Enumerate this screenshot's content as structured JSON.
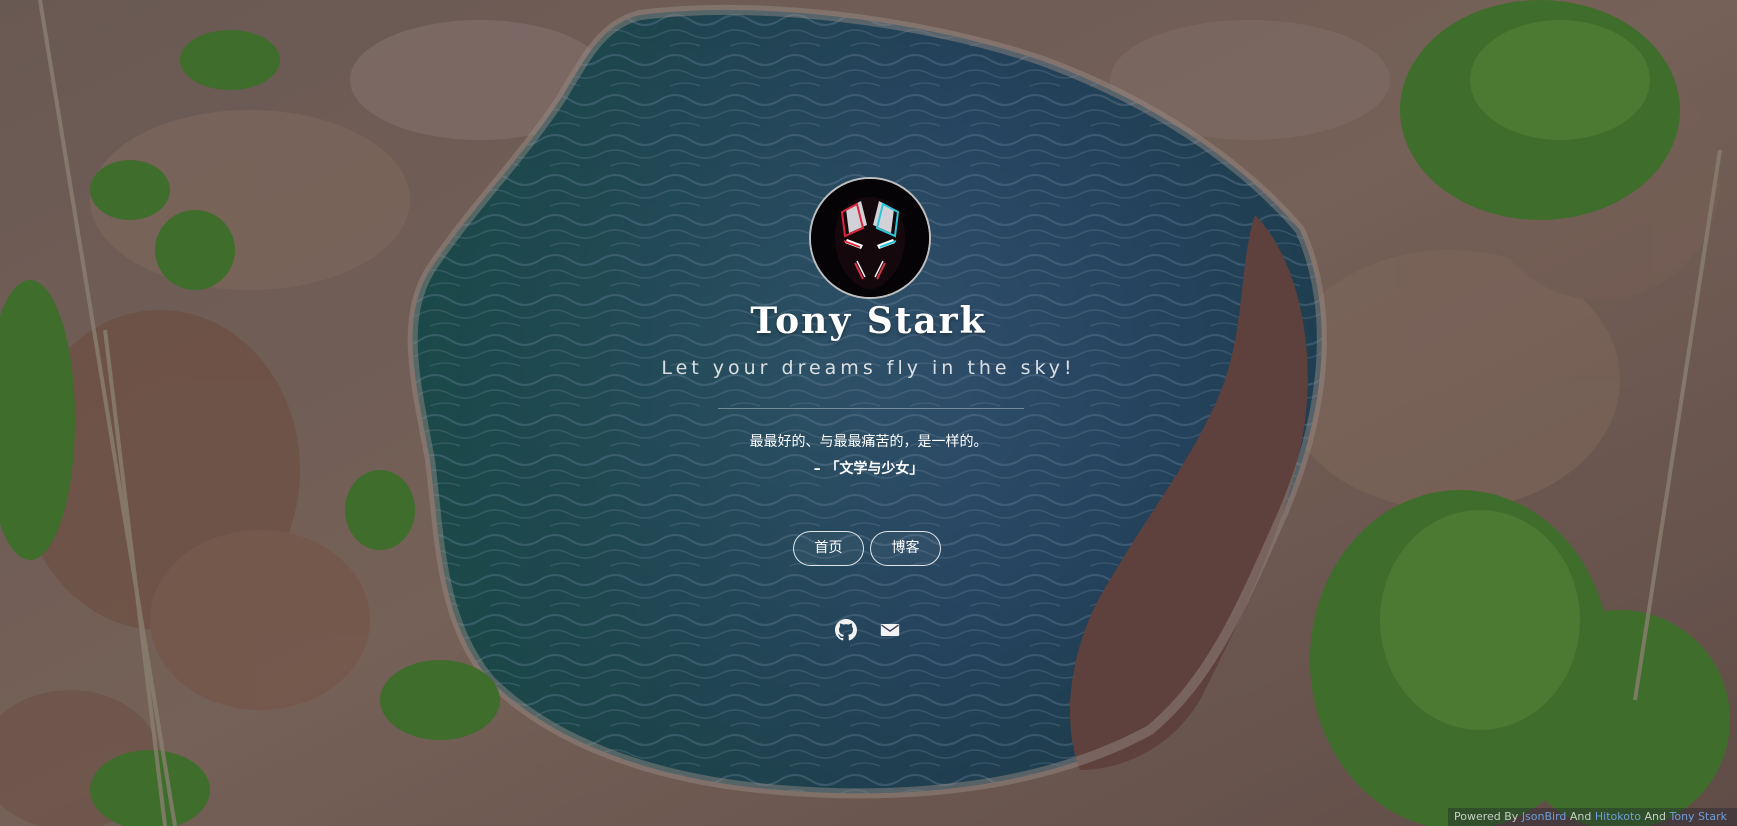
{
  "profile": {
    "avatar_icon": "iron-man-mask-icon",
    "name": "Tony Stark",
    "tagline": "Let your dreams fly in the sky!"
  },
  "quote": {
    "text": "最最好的、与最最痛苦的，是一样的。",
    "source": "– 「文学与少女」"
  },
  "nav": {
    "home_label": "首页",
    "blog_label": "博客"
  },
  "social": {
    "github_icon": "github-icon",
    "email_icon": "mail-icon"
  },
  "footer": {
    "powered_by": "Powered By",
    "link1": "JsonBird",
    "and1": "And",
    "link2": "Hitokoto",
    "and2": "And",
    "link3": "Tony Stark"
  },
  "colors": {
    "footer_link": "#6f9ed6",
    "overlay": "#14162a"
  }
}
